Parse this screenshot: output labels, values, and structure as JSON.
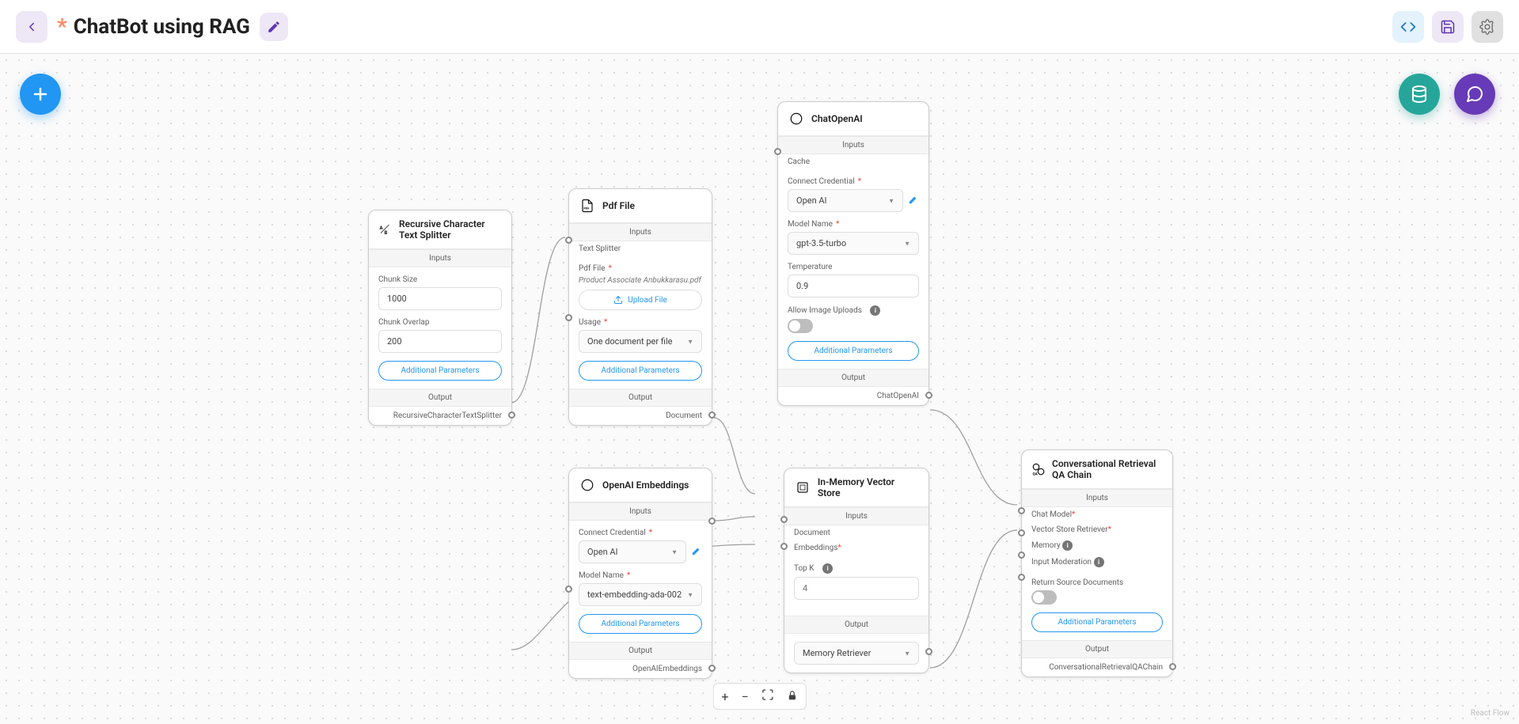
{
  "header": {
    "asterisk": "*",
    "title": "ChatBot using RAG"
  },
  "nodes": {
    "splitter": {
      "title": "Recursive Character Text Splitter",
      "inputs_label": "Inputs",
      "chunk_size_label": "Chunk Size",
      "chunk_size_value": "1000",
      "chunk_overlap_label": "Chunk Overlap",
      "chunk_overlap_value": "200",
      "additional_params": "Additional Parameters",
      "output_label": "Output",
      "output_name": "RecursiveCharacterTextSplitter"
    },
    "pdf": {
      "title": "Pdf File",
      "inputs_label": "Inputs",
      "text_splitter_label": "Text Splitter",
      "pdf_file_label": "Pdf File",
      "file_name": "Product Associate Anbukkarasu.pdf",
      "upload_label": "Upload File",
      "usage_label": "Usage",
      "usage_value": "One document per file",
      "additional_params": "Additional Parameters",
      "output_label": "Output",
      "output_name": "Document"
    },
    "chatopenai": {
      "title": "ChatOpenAI",
      "inputs_label": "Inputs",
      "cache_label": "Cache",
      "credential_label": "Connect Credential",
      "credential_value": "Open AI",
      "model_label": "Model Name",
      "model_value": "gpt-3.5-turbo",
      "temperature_label": "Temperature",
      "temperature_value": "0.9",
      "allow_image_label": "Allow Image Uploads",
      "additional_params": "Additional Parameters",
      "output_label": "Output",
      "output_name": "ChatOpenAI"
    },
    "embeddings": {
      "title": "OpenAI Embeddings",
      "inputs_label": "Inputs",
      "credential_label": "Connect Credential",
      "credential_value": "Open AI",
      "model_label": "Model Name",
      "model_value": "text-embedding-ada-002",
      "additional_params": "Additional Parameters",
      "output_label": "Output",
      "output_name": "OpenAIEmbeddings"
    },
    "vectorstore": {
      "title": "In-Memory Vector Store",
      "inputs_label": "Inputs",
      "document_label": "Document",
      "embeddings_label": "Embeddings",
      "topk_label": "Top K",
      "topk_placeholder": "4",
      "output_label": "Output",
      "output_value": "Memory Retriever"
    },
    "qachain": {
      "title": "Conversational Retrieval QA Chain",
      "inputs_label": "Inputs",
      "chat_model_label": "Chat Model",
      "retriever_label": "Vector Store Retriever",
      "memory_label": "Memory",
      "moderation_label": "Input Moderation",
      "return_docs_label": "Return Source Documents",
      "additional_params": "Additional Parameters",
      "output_label": "Output",
      "output_name": "ConversationalRetrievalQAChain"
    }
  },
  "footer": {
    "attribution": "React Flow"
  }
}
